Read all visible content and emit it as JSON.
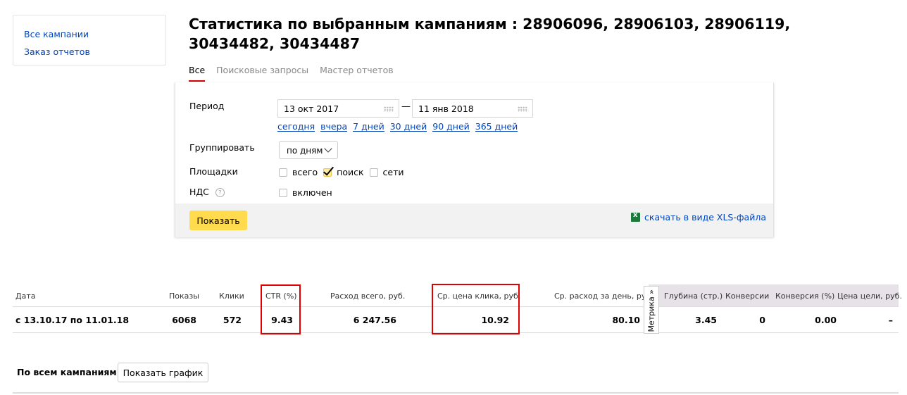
{
  "sidebar": {
    "items": [
      {
        "label": "Все кампании"
      },
      {
        "label": "Заказ отчетов"
      }
    ]
  },
  "page": {
    "title": "Статистика по выбранным кампаниям : 28906096, 28906103, 28906119, 30434482, 30434487"
  },
  "tabs": [
    {
      "label": "Все",
      "active": true
    },
    {
      "label": "Поисковые запросы"
    },
    {
      "label": "Мастер отчетов"
    }
  ],
  "form": {
    "period_label": "Период",
    "date_from": "13 окт 2017",
    "date_to": "11 янв 2018",
    "dash": "—",
    "quick_ranges": [
      "сегодня",
      "вчера",
      "7 дней",
      "30 дней",
      "90 дней",
      "365 дней"
    ],
    "group_label": "Группировать",
    "group_value": "по дням",
    "sites_label": "Площадки",
    "sites": [
      {
        "label": "всего",
        "checked": false
      },
      {
        "label": "поиск",
        "checked": true
      },
      {
        "label": "сети",
        "checked": false
      }
    ],
    "vat_label": "НДС",
    "vat_help": "?",
    "vat_option": {
      "label": "включен",
      "checked": false
    },
    "show_button": "Показать",
    "xls_link": "скачать в виде XLS-файла"
  },
  "stats": {
    "headers": {
      "date": "Дата",
      "impressions": "Показы",
      "clicks": "Клики",
      "ctr": "CTR (%)",
      "spend": "Расход всего, руб.",
      "cpc": "Ср. цена клика, руб.",
      "daily": "Ср. расход за день, руб.",
      "depth": "Глубина (стр.)",
      "conversions": "Конверсии",
      "conv_rate": "Конверсия (%)",
      "goal_cost": "Цена цели, руб."
    },
    "row": {
      "date": "с 13.10.17 по 11.01.18",
      "impressions": "6068",
      "clicks": "572",
      "ctr": "9.43",
      "spend": "6 247.56",
      "cpc": "10.92",
      "daily": "80.10",
      "depth": "3.45",
      "conversions": "0",
      "conv_rate": "0.00",
      "goal_cost": "–"
    },
    "metrika_tab": "Метрика »",
    "highlight_color": "#e00000"
  },
  "footer": {
    "label": "По всем кампаниям",
    "graph_button": "Показать график"
  }
}
